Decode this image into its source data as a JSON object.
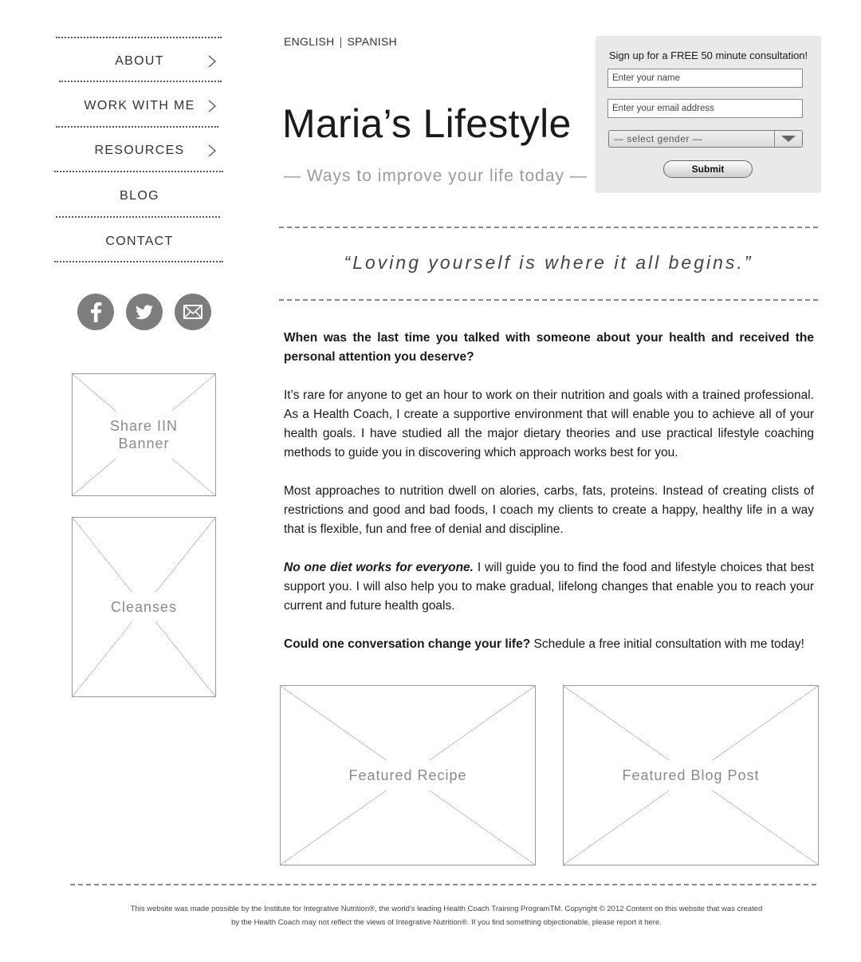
{
  "nav": {
    "items": [
      {
        "label": "ABOUT",
        "has_submenu": true
      },
      {
        "label": "WORK WITH ME",
        "has_submenu": true
      },
      {
        "label": "RESOURCES",
        "has_submenu": true
      },
      {
        "label": "BLOG",
        "has_submenu": false
      },
      {
        "label": "CONTACT",
        "has_submenu": false
      }
    ]
  },
  "social": [
    {
      "icon": "facebook-icon"
    },
    {
      "icon": "twitter-icon"
    },
    {
      "icon": "mail-icon"
    }
  ],
  "sidebar_placeholders": {
    "iin_banner": "Share IIN Banner",
    "cleanses": "Cleanses"
  },
  "header": {
    "lang_english": "ENGLISH",
    "lang_separator": "|",
    "lang_spanish": "SPANISH",
    "site_title": "Maria’s Lifestyle",
    "tagline": "— Ways to improve your life today —"
  },
  "signup": {
    "heading": "Sign up for a FREE 50 minute consultation!",
    "name_placeholder": "Enter your name",
    "email_placeholder": "Enter your email address",
    "gender_selected": "—  select gender  —",
    "submit_label": "Submit"
  },
  "quote": "“Loving yourself is where it all begins.”",
  "content": {
    "intro_question": "When was the last time you talked with someone about your health and received the personal attention you deserve?",
    "para1": "It’s rare for anyone to get an hour to work on their nutrition and goals with a trained professional. As a Health Coach, I create a supportive environment that will enable you to achieve all of your health goals. I have studied all the major dietary theories and use practical lifestyle coaching methods to guide you in discovering which approach works best for you.",
    "para2": "Most approaches to nutrition dwell on  alories, carbs, fats, proteins. Instead of creating clists of restrictions and good and bad foods, I coach my clients to create a happy, healthy life in a way that is flexible, fun and free of denial and discipline.",
    "para3_emphasis": "No one diet works for everyone.",
    "para3_rest": " I will guide you to find the food and lifestyle choices that best support you. I will also help you to make gradual, lifelong changes that enable you to reach your current and future health goals.",
    "cta_bold": "Could one conversation change your life?",
    "cta_rest": " Schedule a free initial consultation with me today!"
  },
  "featured": {
    "recipe": "Featured Recipe",
    "blog_post": "Featured Blog Post"
  },
  "footer": {
    "line1": "This website was made possible by the Institute for Integrative Nutrition®, the world's leading Health Coach Training ProgramTM. Copyright © 2012 Content on this website that was created",
    "line2": "by the Health Coach may not reflect the views of Integrative Nutrition®. If you find something objectionable, please report it here."
  },
  "colors": {
    "social_icon_bg": "#7d7d7d",
    "form_bg": "#e9e9e9",
    "muted_text": "#9a9a9a"
  }
}
